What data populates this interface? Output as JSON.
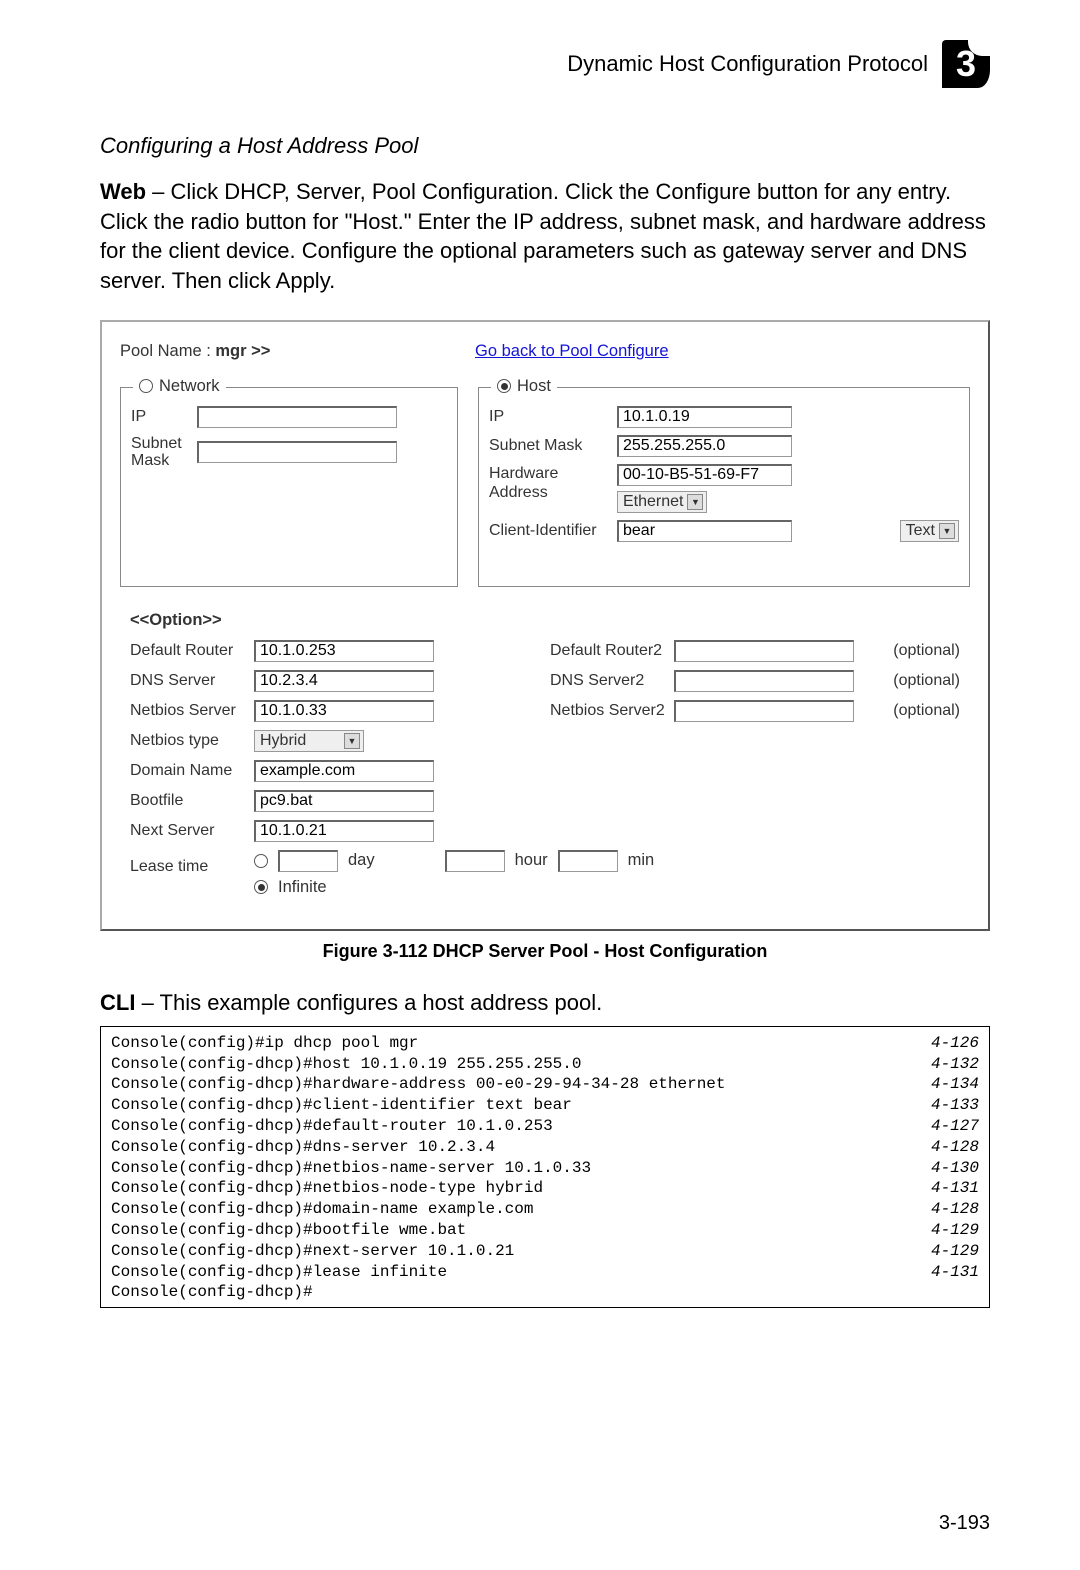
{
  "header": {
    "title": "Dynamic Host Configuration Protocol",
    "chapter": "3"
  },
  "subsection": "Configuring a Host Address Pool",
  "web_para_prefix": "Web",
  "web_para": " – Click DHCP, Server, Pool Configuration. Click the Configure button for any entry. Click the radio button for \"Host.\" Enter the IP address, subnet mask, and hardware address for the client device. Configure the optional parameters such as gateway server and DNS server. Then click Apply.",
  "screenshot": {
    "pool_name_label": "Pool Name : ",
    "pool_name_value": "mgr >>",
    "go_back": "Go back to Pool Configure",
    "network": {
      "legend": "Network",
      "ip_label": "IP",
      "ip_value": "",
      "subnet_label": "Subnet Mask",
      "subnet_value": ""
    },
    "host": {
      "legend": "Host",
      "ip_label": "IP",
      "ip_value": "10.1.0.19",
      "subnet_label": "Subnet Mask",
      "subnet_value": "255.255.255.0",
      "hw_label": "Hardware Address",
      "hw_value": "00-10-B5-51-69-F7",
      "hw_type": "Ethernet",
      "client_id_label": "Client-Identifier",
      "client_id_value": "bear",
      "client_id_type": "Text"
    },
    "options": {
      "header": "<<Option>>",
      "default_router_label": "Default Router",
      "default_router_value": "10.1.0.253",
      "default_router2_label": "Default Router2",
      "default_router2_value": "",
      "optional1": "(optional)",
      "dns_label": "DNS Server",
      "dns_value": "10.2.3.4",
      "dns2_label": "DNS Server2",
      "dns2_value": "",
      "optional2": "(optional)",
      "netbios_label": "Netbios Server",
      "netbios_value": "10.1.0.33",
      "netbios2_label": "Netbios Server2",
      "netbios2_value": "",
      "optional3": "(optional)",
      "netbios_type_label": "Netbios type",
      "netbios_type_value": "Hybrid",
      "domain_label": "Domain Name",
      "domain_value": "example.com",
      "bootfile_label": "Bootfile",
      "bootfile_value": "pc9.bat",
      "next_server_label": "Next Server",
      "next_server_value": "10.1.0.21",
      "lease_label": "Lease time",
      "day_label": "day",
      "hour_label": "hour",
      "min_label": "min",
      "infinite_label": "Infinite"
    }
  },
  "figure_caption": "Figure 3-112   DHCP Server Pool - Host Configuration",
  "cli_prefix": "CLI",
  "cli_para": " – This example configures a host address pool.",
  "cli": [
    {
      "cmd": "Console(config)#ip dhcp pool mgr",
      "ref": "4-126"
    },
    {
      "cmd": "Console(config-dhcp)#host 10.1.0.19 255.255.255.0",
      "ref": "4-132"
    },
    {
      "cmd": "Console(config-dhcp)#hardware-address 00-e0-29-94-34-28 ethernet",
      "ref": "4-134"
    },
    {
      "cmd": "Console(config-dhcp)#client-identifier text bear",
      "ref": "4-133"
    },
    {
      "cmd": "Console(config-dhcp)#default-router 10.1.0.253",
      "ref": "4-127"
    },
    {
      "cmd": "Console(config-dhcp)#dns-server 10.2.3.4",
      "ref": "4-128"
    },
    {
      "cmd": "Console(config-dhcp)#netbios-name-server 10.1.0.33",
      "ref": "4-130"
    },
    {
      "cmd": "Console(config-dhcp)#netbios-node-type hybrid",
      "ref": "4-131"
    },
    {
      "cmd": "Console(config-dhcp)#domain-name example.com",
      "ref": "4-128"
    },
    {
      "cmd": "Console(config-dhcp)#bootfile wme.bat",
      "ref": "4-129"
    },
    {
      "cmd": "Console(config-dhcp)#next-server 10.1.0.21",
      "ref": "4-129"
    },
    {
      "cmd": "Console(config-dhcp)#lease infinite",
      "ref": "4-131"
    },
    {
      "cmd": "Console(config-dhcp)#",
      "ref": ""
    }
  ],
  "page_number": "3-193"
}
